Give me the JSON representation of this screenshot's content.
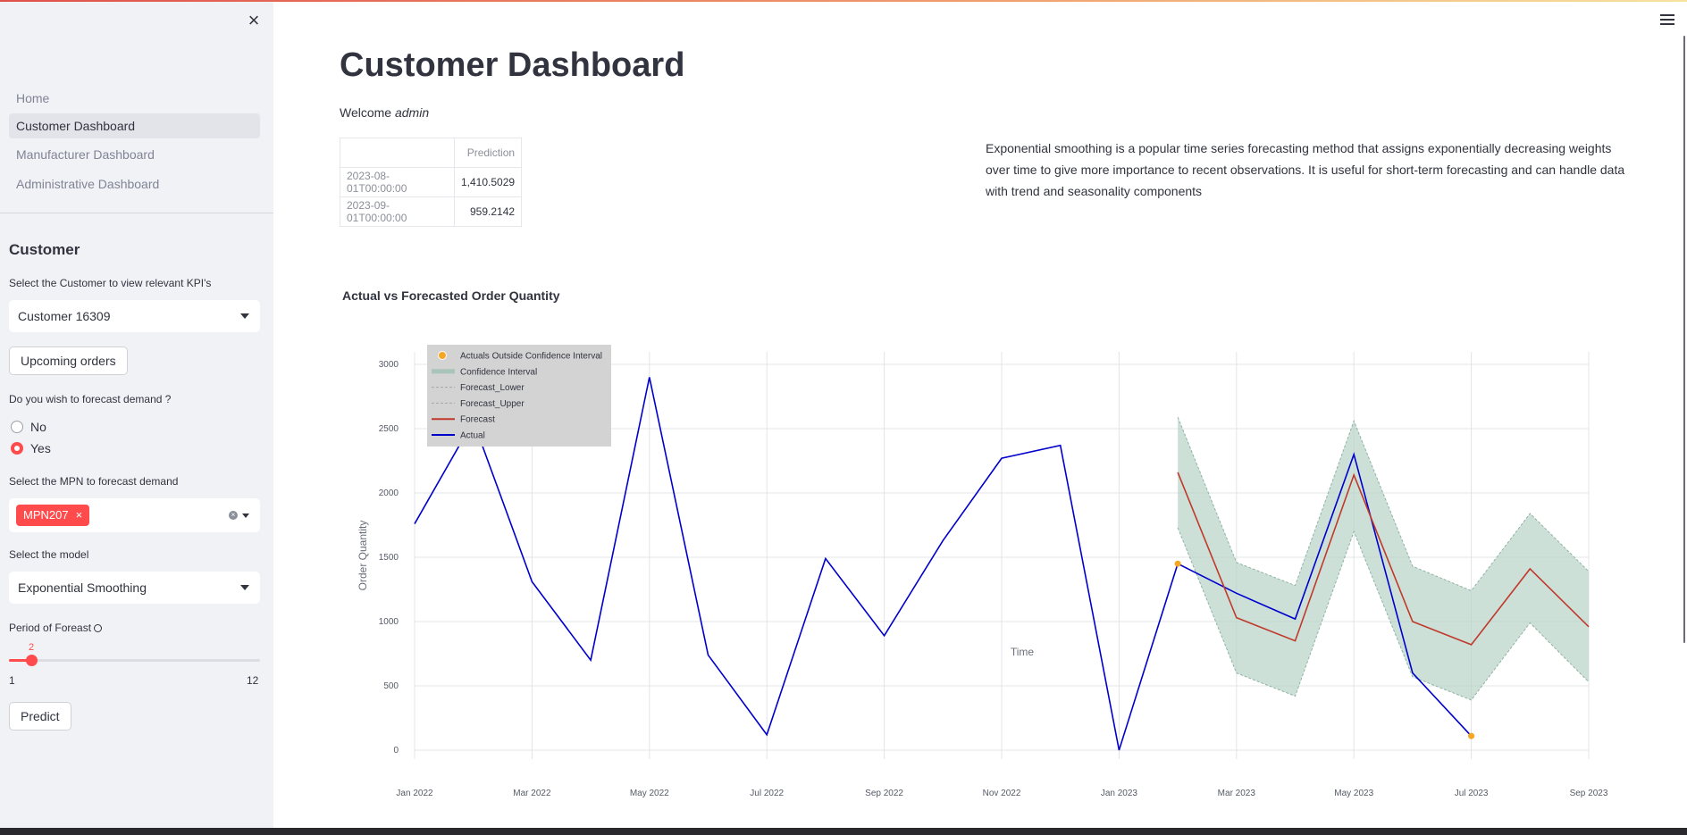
{
  "sidebar": {
    "close_icon": "×",
    "nav": [
      "Home",
      "Customer Dashboard",
      "Manufacturer Dashboard",
      "Administrative Dashboard"
    ],
    "active_nav": "Customer Dashboard",
    "section_header": "Customer",
    "customer_label": "Select the Customer to view relevant KPI's",
    "customer_value": "Customer 16309",
    "upcoming_button": "Upcoming orders",
    "forecast_question": "Do you wish to forecast demand ?",
    "radio_no": "No",
    "radio_yes": "Yes",
    "radio_selected": "Yes",
    "mpn_label": "Select the MPN to forecast demand",
    "mpn_tag": "MPN207",
    "mpn_tag_close": "×",
    "model_label": "Select the model",
    "model_value": "Exponential Smoothing",
    "period_label": "Period of Foreast",
    "slider_value": "2",
    "slider_min": "1",
    "slider_max": "12",
    "predict_button": "Predict"
  },
  "main": {
    "title": "Customer Dashboard",
    "welcome_prefix": "Welcome ",
    "welcome_user": "admin",
    "table": {
      "header": "Prediction",
      "rows": [
        {
          "index": "2023-08-01T00:00:00",
          "value": "1,410.5029"
        },
        {
          "index": "2023-09-01T00:00:00",
          "value": "959.2142"
        }
      ]
    },
    "description": "Exponential smoothing is a popular time series forecasting method that assigns exponentially decreasing weights over time to give more importance to recent observations. It is useful for short-term forecasting and can handle data with trend and seasonality components",
    "chart_title": "Actual vs Forecasted Order Quantity"
  },
  "colors": {
    "accent": "#ff4b4b",
    "actual": "#0000cc",
    "forecast": "#c0392b",
    "ci_fill": "#b7d3c8",
    "outlier": "#f5a623"
  },
  "chart_data": {
    "type": "line",
    "xlabel": "Time",
    "ylabel": "Order Quantity",
    "x_ticks": [
      "Jan 2022",
      "Mar 2022",
      "May 2022",
      "Jul 2022",
      "Sep 2022",
      "Nov 2022",
      "Jan 2023",
      "Mar 2023",
      "May 2023",
      "Jul 2023",
      "Sep 2023"
    ],
    "y_ticks": [
      "0",
      "500",
      "1000",
      "1500",
      "2000",
      "2500",
      "3000"
    ],
    "ylim": [
      0,
      3000
    ],
    "xlim": [
      "2022-01",
      "2023-09"
    ],
    "grid": true,
    "legend_position": "top-left",
    "legend": [
      "Actuals Outside Confidence Interval",
      "Confidence Interval",
      "Forecast_Lower",
      "Forecast_Upper",
      "Forecast",
      "Actual"
    ],
    "series": [
      {
        "name": "Actual",
        "x": [
          "2022-01",
          "2022-02",
          "2022-03",
          "2022-04",
          "2022-05",
          "2022-06",
          "2022-07",
          "2022-08",
          "2022-09",
          "2022-10",
          "2022-11",
          "2022-12",
          "2023-01",
          "2023-02",
          "2023-03",
          "2023-04",
          "2023-05",
          "2023-06",
          "2023-07"
        ],
        "values": [
          1760,
          2560,
          1310,
          700,
          2900,
          740,
          120,
          1490,
          890,
          1630,
          2270,
          2370,
          0,
          1450,
          1220,
          1020,
          2300,
          600,
          110
        ]
      },
      {
        "name": "Forecast",
        "x": [
          "2023-02",
          "2023-03",
          "2023-04",
          "2023-05",
          "2023-06",
          "2023-07",
          "2023-08",
          "2023-09"
        ],
        "values": [
          2160,
          1030,
          850,
          2140,
          1000,
          820,
          1410,
          960
        ]
      },
      {
        "name": "Forecast_Upper",
        "x": [
          "2023-02",
          "2023-03",
          "2023-04",
          "2023-05",
          "2023-06",
          "2023-07",
          "2023-08",
          "2023-09"
        ],
        "values": [
          2590,
          1460,
          1280,
          2560,
          1430,
          1240,
          1840,
          1390
        ]
      },
      {
        "name": "Forecast_Lower",
        "x": [
          "2023-02",
          "2023-03",
          "2023-04",
          "2023-05",
          "2023-06",
          "2023-07",
          "2023-08",
          "2023-09"
        ],
        "values": [
          1730,
          600,
          420,
          1700,
          570,
          390,
          990,
          530
        ]
      },
      {
        "name": "Actuals Outside Confidence Interval",
        "x": [
          "2023-02",
          "2023-07"
        ],
        "values": [
          1450,
          110
        ]
      }
    ]
  }
}
